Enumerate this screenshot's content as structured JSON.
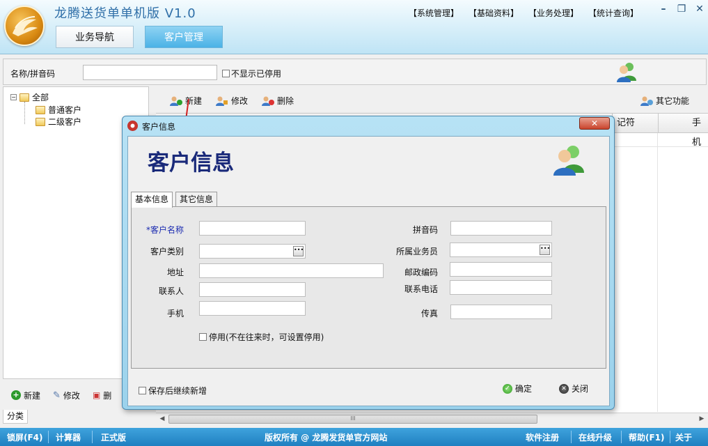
{
  "app": {
    "title": "龙腾送货单单机版 V1.0",
    "menu": [
      "【系统管理】",
      "【基础资料】",
      "【业务处理】",
      "【统计查询】"
    ],
    "nav_tabs": [
      {
        "label": "业务导航",
        "active": false
      },
      {
        "label": "客户管理",
        "active": true
      }
    ],
    "accent_color": "#4bb2e6"
  },
  "search": {
    "label": "名称/拼音码",
    "value": "",
    "hide_disabled_label": "不显示已停用",
    "hide_disabled_checked": false
  },
  "tree": {
    "root": "全部",
    "children": [
      "普通客户",
      "二级客户"
    ]
  },
  "left_actions": {
    "new": "新建",
    "edit": "修改",
    "delete_partial": "删"
  },
  "category_tab": "分类",
  "toolbar": {
    "new": "新建",
    "edit": "修改",
    "delete": "删除",
    "other": "其它功能"
  },
  "grid": {
    "headers_visible": [
      "记符",
      "手机"
    ]
  },
  "dialog": {
    "title": "客户信息",
    "heading": "客户信息",
    "tabs": [
      "基本信息",
      "其它信息"
    ],
    "active_tab": "基本信息",
    "fields": {
      "customer_name": {
        "label": "*客户名称",
        "value": ""
      },
      "pinyin": {
        "label": "拼音码",
        "value": ""
      },
      "customer_type": {
        "label": "客户类别",
        "value": ""
      },
      "salesman": {
        "label": "所属业务员",
        "value": ""
      },
      "address": {
        "label": "地址",
        "value": ""
      },
      "postcode": {
        "label": "邮政编码",
        "value": ""
      },
      "contact": {
        "label": "联系人",
        "value": ""
      },
      "phone": {
        "label": "联系电话",
        "value": ""
      },
      "mobile": {
        "label": "手机",
        "value": ""
      },
      "fax": {
        "label": "传真",
        "value": ""
      }
    },
    "disabled_label": "停用(不在往来时，可设置停用)",
    "disabled_checked": false,
    "keep_adding_label": "保存后继续新增",
    "keep_adding_checked": false,
    "ok": "确定",
    "close": "关闭",
    "required_color": "#1a2ab0"
  },
  "status": {
    "lock": "锁屏(F4)",
    "calculator": "计算器",
    "edition": "正式版",
    "copyright": "版权所有 @ 龙腾发货单官方网站",
    "register": "软件注册",
    "upgrade": "在线升级",
    "help": "帮助(F1)",
    "about": "关于"
  }
}
